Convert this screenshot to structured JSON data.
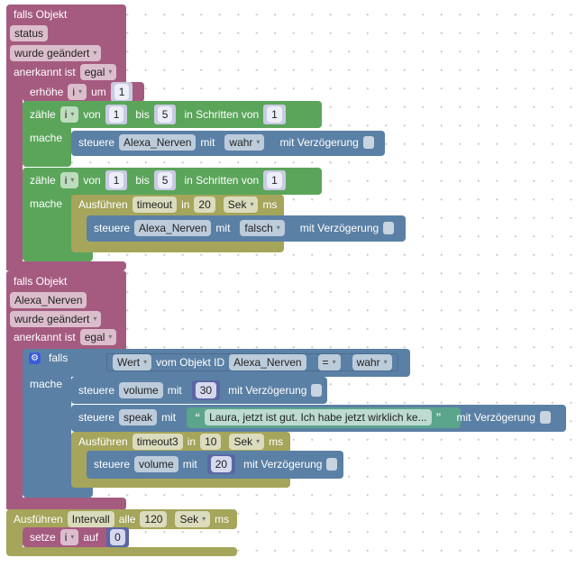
{
  "trigger1": {
    "title": "falls Objekt",
    "object": "status",
    "mode": "wurde geändert",
    "ack_label": "anerkannt ist",
    "ack": "egal",
    "increment": {
      "label": "erhöhe",
      "var": "i",
      "by": "um",
      "value": "1"
    },
    "loop1": {
      "label": "zähle",
      "var": "i",
      "from": "von",
      "from_val": "1",
      "to": "bis",
      "to_val": "5",
      "step": "in Schritten von",
      "step_val": "1",
      "do": "mache",
      "control": {
        "label": "steuere",
        "object": "Alexa_Nerven",
        "with": "mit",
        "value": "wahr",
        "delay": "mit Verzögerung"
      }
    },
    "loop2": {
      "label": "zähle",
      "var": "i",
      "from": "von",
      "from_val": "1",
      "to": "bis",
      "to_val": "5",
      "step": "in Schritten von",
      "step_val": "1",
      "do": "mache",
      "timeout": {
        "label": "Ausführen",
        "name": "timeout",
        "in": "in",
        "value": "20",
        "unit": "Sek",
        "ms": "ms"
      },
      "control": {
        "label": "steuere",
        "object": "Alexa_Nerven",
        "with": "mit",
        "value": "falsch",
        "delay": "mit Verzögerung"
      }
    }
  },
  "trigger2": {
    "title": "falls Objekt",
    "object": "Alexa_Nerven",
    "mode": "wurde geändert",
    "ack_label": "anerkannt ist",
    "ack": "egal",
    "if": {
      "label": "falls",
      "do": "mache",
      "prop": "Wert",
      "of": "vom Objekt ID",
      "object": "Alexa_Nerven",
      "op": "=",
      "value": "wahr"
    },
    "c1": {
      "label": "steuere",
      "object": "volume",
      "with": "mit",
      "value": "30",
      "delay": "mit Verzögerung"
    },
    "c2": {
      "label": "steuere",
      "object": "speak",
      "with": "mit",
      "text": "Laura, jetzt ist gut. Ich habe jetzt wirklich ke...",
      "open_quote": "“",
      "close_quote": "”",
      "delay": "mit Verzögerung"
    },
    "timeout": {
      "label": "Ausführen",
      "name": "timeout3",
      "in": "in",
      "value": "10",
      "unit": "Sek",
      "ms": "ms"
    },
    "c3": {
      "label": "steuere",
      "object": "volume",
      "with": "mit",
      "value": "20",
      "delay": "mit Verzögerung"
    }
  },
  "interval": {
    "label": "Ausführen",
    "name": "Intervall",
    "every": "alle",
    "value": "120",
    "unit": "Sek",
    "ms": "ms",
    "set": {
      "label": "setze",
      "var": "i",
      "to": "auf",
      "value": "0"
    }
  }
}
